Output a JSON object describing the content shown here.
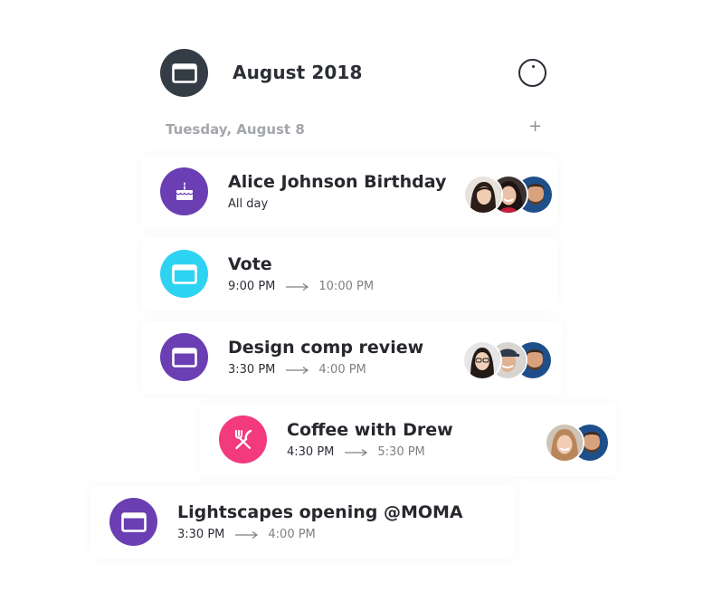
{
  "header": {
    "month": "August 2018",
    "icon": "calendar-icon",
    "clock_icon": "clock-icon"
  },
  "day": {
    "label": "Tuesday, August 8",
    "add_symbol": "+"
  },
  "colors": {
    "purple": "#6b3fb3",
    "cyan": "#2ed3f2",
    "pink": "#f23a7d",
    "dark": "#343d46"
  },
  "events": [
    {
      "title": "Alice Johnson Birthday",
      "subtitle": "All day",
      "icon": "cake-icon",
      "color": "#6b3fb3",
      "attendees": 3
    },
    {
      "title": "Vote",
      "start": "9:00 PM",
      "end": "10:00 PM",
      "icon": "calendar-icon",
      "color": "#2ed3f2",
      "attendees": 0
    },
    {
      "title": "Design comp review",
      "start": "3:30 PM",
      "end": "4:00 PM",
      "icon": "calendar-icon",
      "color": "#6b3fb3",
      "attendees": 3
    },
    {
      "title": "Coffee with Drew",
      "start": "4:30 PM",
      "end": "5:30 PM",
      "icon": "fork-knife-icon",
      "color": "#f23a7d",
      "attendees": 2
    },
    {
      "title": "Lightscapes opening @MOMA",
      "start": "3:30 PM",
      "end": "4:00 PM",
      "icon": "calendar-icon",
      "color": "#6b3fb3",
      "attendees": 0
    }
  ]
}
